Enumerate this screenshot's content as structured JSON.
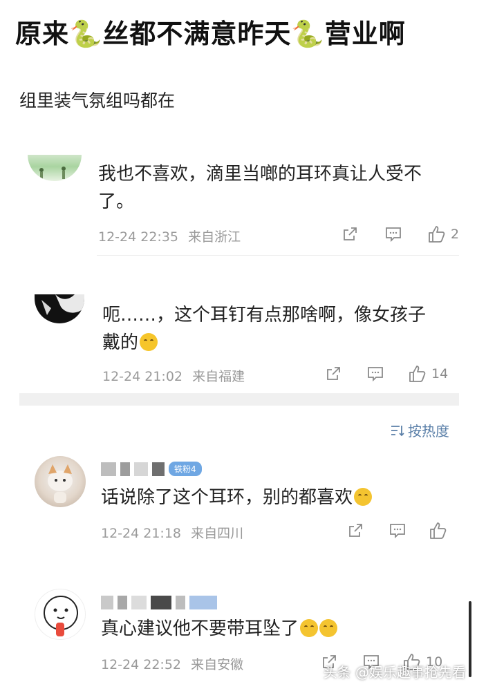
{
  "headline": {
    "part1": "原来",
    "part2": "丝都不满意昨天",
    "part3": "营业啊",
    "snake": "🐍"
  },
  "subtitle": "组里装气氛组吗都在",
  "comments": [
    {
      "text": "我也不喜欢，滴里当啷的耳环真让人受不了。",
      "time": "12-24 22:35",
      "location": "来自浙江",
      "likes": "2"
    },
    {
      "text": "呃……，这个耳钉有点那啥啊，像女孩子戴的",
      "time": "12-24 21:02",
      "location": "来自福建",
      "likes": "14"
    },
    {
      "badge": "铁粉4",
      "text": "话说除了这个耳环，别的都喜欢",
      "time": "12-24 21:18",
      "location": "来自四川",
      "likes": ""
    },
    {
      "text": "真心建议他不要带耳坠了",
      "time": "12-24 22:52",
      "location": "来自安徽",
      "likes": "10"
    }
  ],
  "sort_label": "按热度",
  "watermark": "头条 @娱乐趣事抢先看",
  "colors": {
    "link_blue": "#5a7fa8",
    "meta_gray": "#9a9a9a",
    "badge_blue": "#6fa7e3"
  }
}
